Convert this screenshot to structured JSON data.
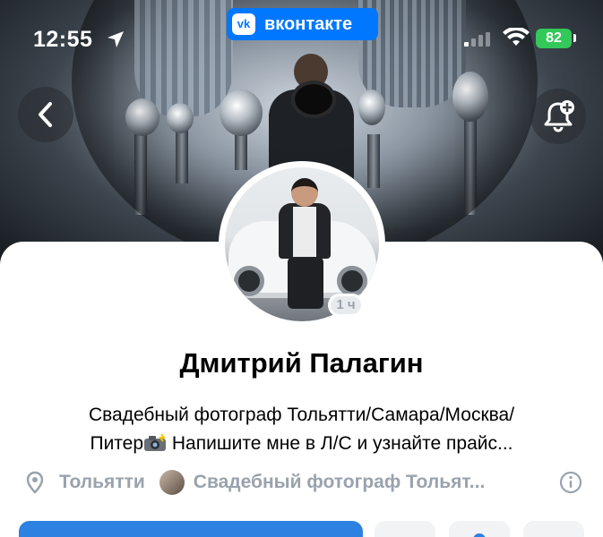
{
  "status_bar": {
    "time": "12:55",
    "battery": "82",
    "battery_color": "#34c759"
  },
  "app_badge": {
    "label": "вконтакте",
    "logo_text": "vk",
    "color": "#0077ff"
  },
  "header": {
    "back_icon": "chevron-left-icon",
    "notify_icon": "bell-plus-icon"
  },
  "profile": {
    "name": "Дмитрий Палагин",
    "online_badge": "1 ч",
    "status_line1": "Свадебный фотограф Тольятти/Самара/Москва/",
    "status_line2_a": "Питер",
    "status_line2_b": " Напишите мне в Л/С и узнайте прайс...",
    "city": "Тольятти",
    "group": "Свадебный фотограф Тольят..."
  },
  "colors": {
    "accent": "#2d81e0",
    "muted_text": "#99a2ad"
  }
}
